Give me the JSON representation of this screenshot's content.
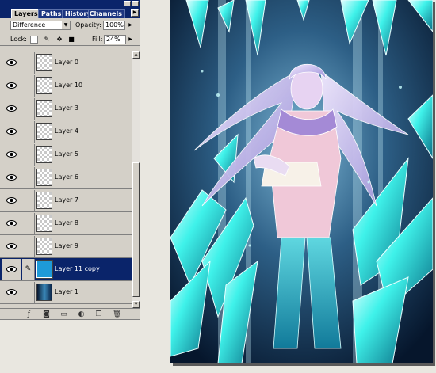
{
  "layers_panel": {
    "tabs": [
      {
        "label": "Layers",
        "active": true
      },
      {
        "label": "Paths",
        "active": false
      },
      {
        "label": "History",
        "active": false
      },
      {
        "label": "Channels",
        "active": false
      }
    ],
    "blend_mode": "Difference",
    "opacity_label": "Opacity:",
    "opacity_value": "100%",
    "lock_label": "Lock:",
    "fill_label": "Fill:",
    "fill_value": "24%",
    "layers": [
      {
        "name": "Layer 0",
        "thumb": "transparent",
        "visible": true,
        "selected": false
      },
      {
        "name": "Layer 10",
        "thumb": "transparent",
        "visible": true,
        "selected": false
      },
      {
        "name": "Layer 3",
        "thumb": "transparent",
        "visible": true,
        "selected": false
      },
      {
        "name": "Layer 4",
        "thumb": "transparent",
        "visible": true,
        "selected": false
      },
      {
        "name": "Layer 5",
        "thumb": "transparent",
        "visible": true,
        "selected": false
      },
      {
        "name": "Layer 6",
        "thumb": "transparent",
        "visible": true,
        "selected": false
      },
      {
        "name": "Layer 7",
        "thumb": "transparent",
        "visible": true,
        "selected": false
      },
      {
        "name": "Layer 8",
        "thumb": "transparent",
        "visible": true,
        "selected": false
      },
      {
        "name": "Layer 9",
        "thumb": "transparent",
        "visible": true,
        "selected": false
      },
      {
        "name": "Layer 11 copy",
        "thumb": "cyan",
        "visible": true,
        "selected": true,
        "linked_icon": "brush-icon"
      },
      {
        "name": "Layer 1",
        "thumb": "background",
        "visible": true,
        "selected": false
      }
    ],
    "bottom_buttons": [
      "link-layers-icon",
      "layer-style-icon",
      "mask-icon",
      "new-set-icon",
      "adjustment-layer-icon",
      "new-layer-icon",
      "trash-icon"
    ]
  },
  "colors": {
    "titlebar": "#0a246a",
    "selection": "#0a246a",
    "panel": "#d4d0c8",
    "glow": "#38f0e8"
  }
}
